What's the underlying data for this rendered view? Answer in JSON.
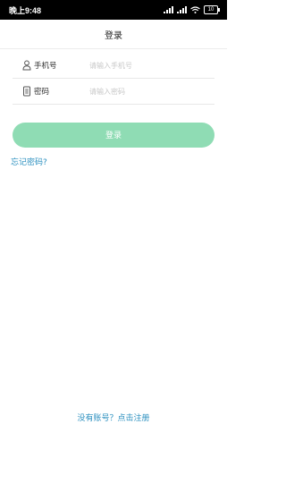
{
  "status_bar": {
    "time": "晚上9:48",
    "battery": "10"
  },
  "header": {
    "title": "登录"
  },
  "form": {
    "phone": {
      "label": "手机号",
      "placeholder": "请输入手机号",
      "icon": "user-icon"
    },
    "password": {
      "label": "密码",
      "placeholder": "请输入密码",
      "icon": "lock-icon"
    }
  },
  "actions": {
    "login_label": "登录",
    "forgot_label": "忘记密码?",
    "register_label": "没有账号？点击注册"
  },
  "colors": {
    "accent": "#8fdcb4",
    "link": "#2a8fbf"
  }
}
